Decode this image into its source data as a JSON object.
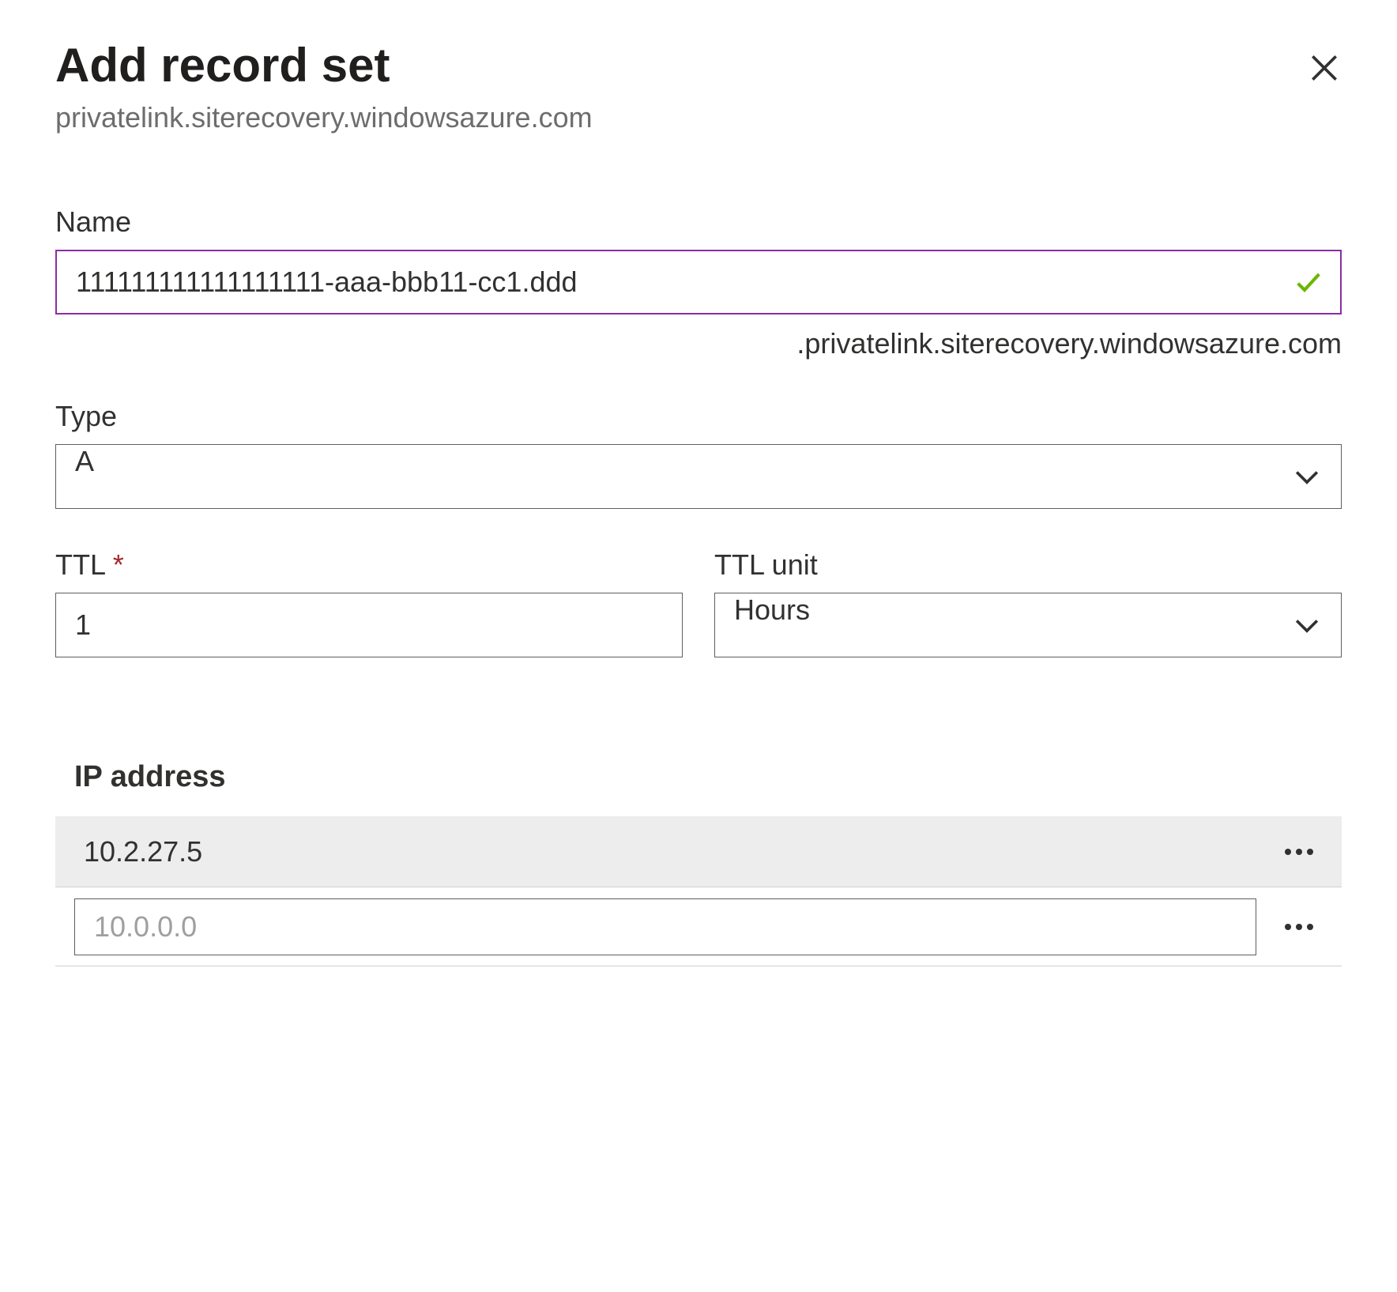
{
  "header": {
    "title": "Add record set",
    "subtitle": "privatelink.siterecovery.windowsazure.com"
  },
  "fields": {
    "name": {
      "label": "Name",
      "value": "111111111111111111-aaa-bbb11-cc1.ddd",
      "suffix": ".privatelink.siterecovery.windowsazure.com"
    },
    "type": {
      "label": "Type",
      "value": "A"
    },
    "ttl": {
      "label": "TTL",
      "value": "1"
    },
    "ttl_unit": {
      "label": "TTL unit",
      "value": "Hours"
    }
  },
  "ip_section": {
    "label": "IP address",
    "rows": [
      {
        "value": "10.2.27.5"
      }
    ],
    "new_placeholder": "10.0.0.0"
  }
}
